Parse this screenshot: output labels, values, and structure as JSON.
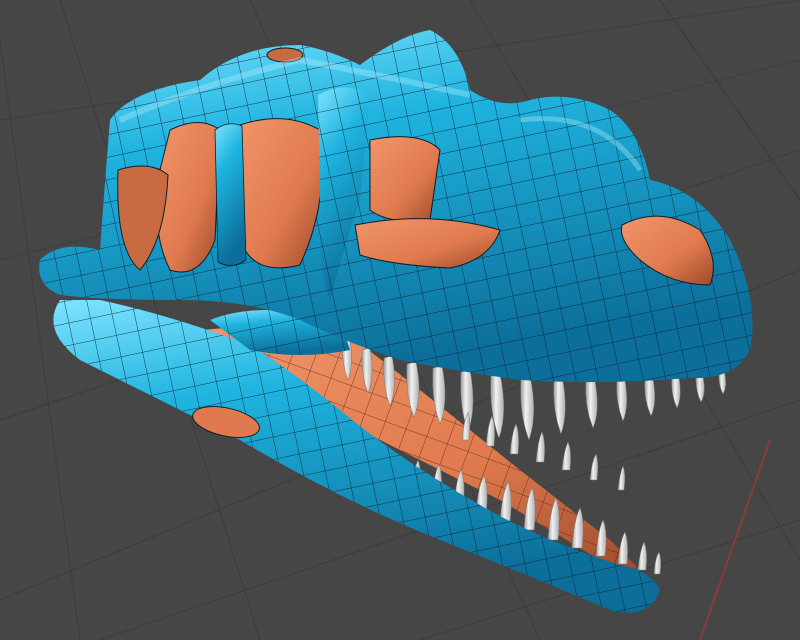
{
  "scene": {
    "subject": "dinosaur-skull-3d-model",
    "shading": "subdivision-surface-wireframe",
    "colors": {
      "background": "#464646",
      "grid": "#3b3b3b",
      "outer_surface": "#1fb4e0",
      "outer_surface_highlight": "#7fe3ff",
      "outer_surface_shadow": "#0c6e9a",
      "inner_surface": "#e07a4e",
      "inner_surface_shadow": "#9c4a2c",
      "teeth": "#dcdcdc",
      "wire": "#0b1e2a",
      "axis_red": "#8a3a3a"
    }
  }
}
